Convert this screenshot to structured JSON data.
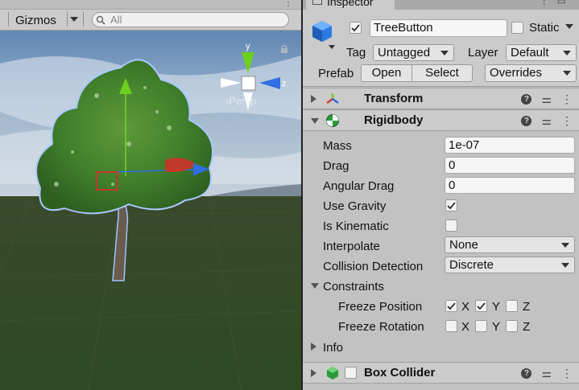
{
  "scene": {
    "gizmos_label": "Gizmos",
    "search_placeholder": "All",
    "persp_label": "‹Persp",
    "axes": {
      "y": "y",
      "z": "z"
    }
  },
  "inspector": {
    "tab_title": "Inspector",
    "object": {
      "name": "TreeButton",
      "active": true,
      "static_label": "Static",
      "static": false,
      "tag_label": "Tag",
      "tag_value": "Untagged",
      "layer_label": "Layer",
      "layer_value": "Default",
      "prefab_label": "Prefab",
      "open_label": "Open",
      "select_label": "Select",
      "overrides_label": "Overrides"
    },
    "components": {
      "transform": {
        "title": "Transform"
      },
      "rigidbody": {
        "title": "Rigidbody",
        "mass_label": "Mass",
        "mass": "1e-07",
        "drag_label": "Drag",
        "drag": "0",
        "angular_drag_label": "Angular Drag",
        "angular_drag": "0",
        "use_gravity_label": "Use Gravity",
        "use_gravity": true,
        "is_kinematic_label": "Is Kinematic",
        "is_kinematic": false,
        "interpolate_label": "Interpolate",
        "interpolate": "None",
        "collision_label": "Collision Detection",
        "collision": "Discrete",
        "constraints_label": "Constraints",
        "freeze_position_label": "Freeze Position",
        "freeze_rotation_label": "Freeze Rotation",
        "axis_x": "X",
        "axis_y": "Y",
        "axis_z": "Z",
        "freeze_position": [
          true,
          true,
          false
        ],
        "freeze_rotation": [
          false,
          false,
          false
        ],
        "info_label": "Info"
      },
      "box_collider": {
        "title": "Box Collider",
        "enabled": false
      }
    }
  },
  "colors": {
    "unity_blue": "#2b7be0",
    "gizmo_green": "#6ccf1e",
    "gizmo_blue": "#2f6fe0",
    "gizmo_red": "#c0392b"
  }
}
